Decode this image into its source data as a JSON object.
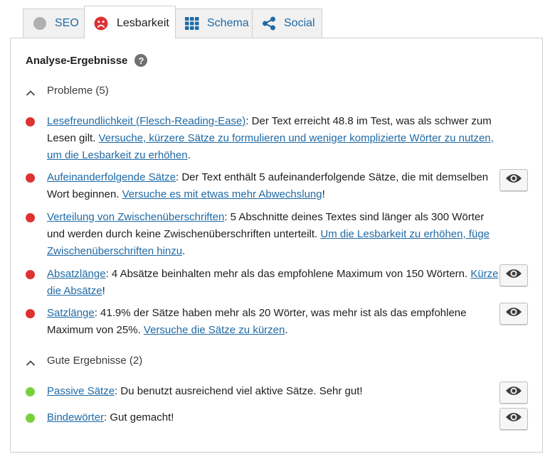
{
  "tabs": [
    {
      "label": "SEO",
      "icon": "grey-circle-icon"
    },
    {
      "label": "Lesbarkeit",
      "icon": "sad-face-icon"
    },
    {
      "label": "Schema",
      "icon": "grid-icon"
    },
    {
      "label": "Social",
      "icon": "share-icon"
    }
  ],
  "colors": {
    "accent": "#1f6aa5",
    "bad": "#dc3232",
    "good": "#7ad03a"
  },
  "panel": {
    "heading": "Analyse-Ergebnisse",
    "help_glyph": "?",
    "problems_label": "Probleme (5)",
    "good_label": "Gute Ergebnisse (2)"
  },
  "problems": [
    {
      "link": "Lesefreundlichkeit (Flesch-Reading-Ease)",
      "text": ": Der Text erreicht 48.8 im Test, was als schwer zum Lesen gilt. ",
      "action": "Versuche, kürzere Sätze zu formulieren und weniger komplizierte Wörter zu nutzen, um die Lesbarkeit zu erhöhen",
      "end": "."
    },
    {
      "link": "Aufeinanderfolgende Sätze",
      "text": ": Der Text enthält 5 aufeinanderfolgende Sätze, die mit demselben Wort beginnen. ",
      "action": "Versuche es mit etwas mehr Abwechslung",
      "end": "!"
    },
    {
      "link": "Verteilung von Zwischenüberschriften",
      "text": ": 5 Abschnitte deines Textes sind länger als 300 Wörter und werden durch keine Zwischenüberschriften unterteilt. ",
      "action": "Um die Lesbarkeit zu erhöhen, füge Zwischenüberschriften hinzu",
      "end": "."
    },
    {
      "link": "Absatzlänge",
      "text": ": 4 Absätze beinhalten mehr als das empfohlene Maximum von 150 Wörtern. ",
      "action": "Kürze die Absätze",
      "end": "!"
    },
    {
      "link": "Satzlänge",
      "text": ": 41.9% der Sätze haben mehr als 20 Wörter, was mehr ist als das empfohlene Maximum von 25%. ",
      "action": "Versuche die Sätze zu kürzen",
      "end": "."
    }
  ],
  "good": [
    {
      "link": "Passive Sätze",
      "text": ": Du benutzt ausreichend viel aktive Sätze. Sehr gut!"
    },
    {
      "link": "Bindewörter",
      "text": ": Gut gemacht!"
    }
  ]
}
